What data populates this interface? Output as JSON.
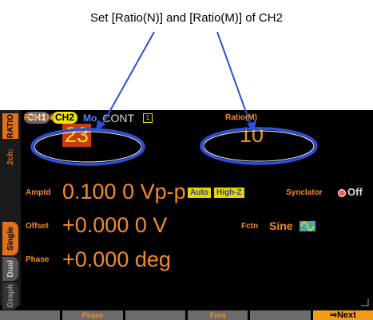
{
  "caption": "Set [Ratio(N)] and [Ratio(M)] of CH2",
  "sidebar": {
    "ratio_tab": "RATIO",
    "twoch_tab": "2ch:",
    "single_tab": "Single",
    "dual_tab": "Dual",
    "graph_tab": "Graph"
  },
  "topbar": {
    "ch1": "CH1",
    "ch2": "CH2",
    "mode": "Mo",
    "cont": "CONT",
    "lock_glyph": "1"
  },
  "ratio_n": {
    "label": "Ratio(N)",
    "value": "23"
  },
  "ratio_m": {
    "label": "Ratio(M)",
    "value": "10"
  },
  "amptd": {
    "label": "Amptd",
    "value": "0.100 0 Vp-p",
    "auto": "Auto",
    "highz": "High-Z",
    "synclator_label": "Synclator",
    "synclator_value": "Off"
  },
  "offset": {
    "label": "Offset",
    "value": "+0.000 0 V",
    "fctn_label": "Fctn",
    "fctn_value": "Sine"
  },
  "phase": {
    "label": "Phase",
    "value": "+0.000 deg"
  },
  "fkeys": [
    "",
    "Phase",
    "",
    "Freq",
    "",
    "⇒Next"
  ],
  "colors": {
    "accent": "#f28c28",
    "highlight": "#f2e600",
    "ellipse": "#2e4fd6"
  }
}
